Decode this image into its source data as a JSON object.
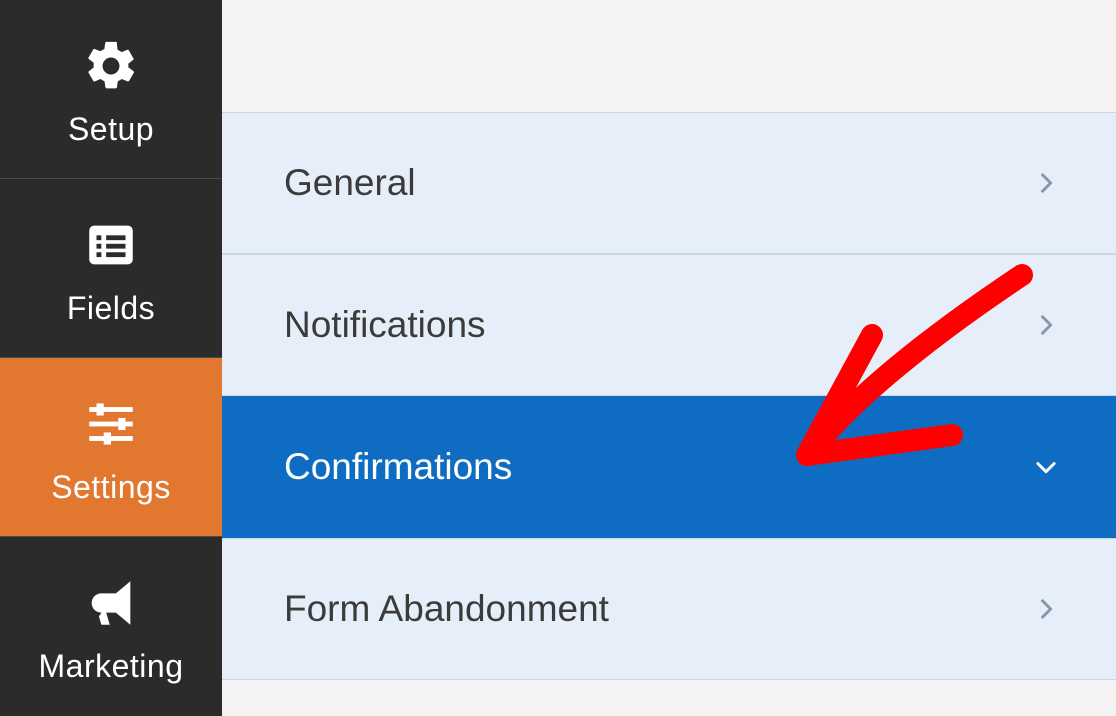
{
  "sidebar": {
    "items": [
      {
        "id": "setup",
        "label": "Setup",
        "icon": "gear-icon",
        "active": false
      },
      {
        "id": "fields",
        "label": "Fields",
        "icon": "list-icon",
        "active": false
      },
      {
        "id": "settings",
        "label": "Settings",
        "icon": "sliders-icon",
        "active": true
      },
      {
        "id": "marketing",
        "label": "Marketing",
        "icon": "bullhorn-icon",
        "active": false
      }
    ]
  },
  "panel": {
    "rows": [
      {
        "id": "general",
        "label": "General",
        "active": false,
        "expanded": false
      },
      {
        "id": "notifications",
        "label": "Notifications",
        "active": false,
        "expanded": false
      },
      {
        "id": "confirmations",
        "label": "Confirmations",
        "active": true,
        "expanded": true
      },
      {
        "id": "form-abandonment",
        "label": "Form Abandonment",
        "active": false,
        "expanded": false
      }
    ]
  },
  "annotation": {
    "type": "arrow",
    "color": "#ff0000",
    "points_to": "confirmations"
  }
}
